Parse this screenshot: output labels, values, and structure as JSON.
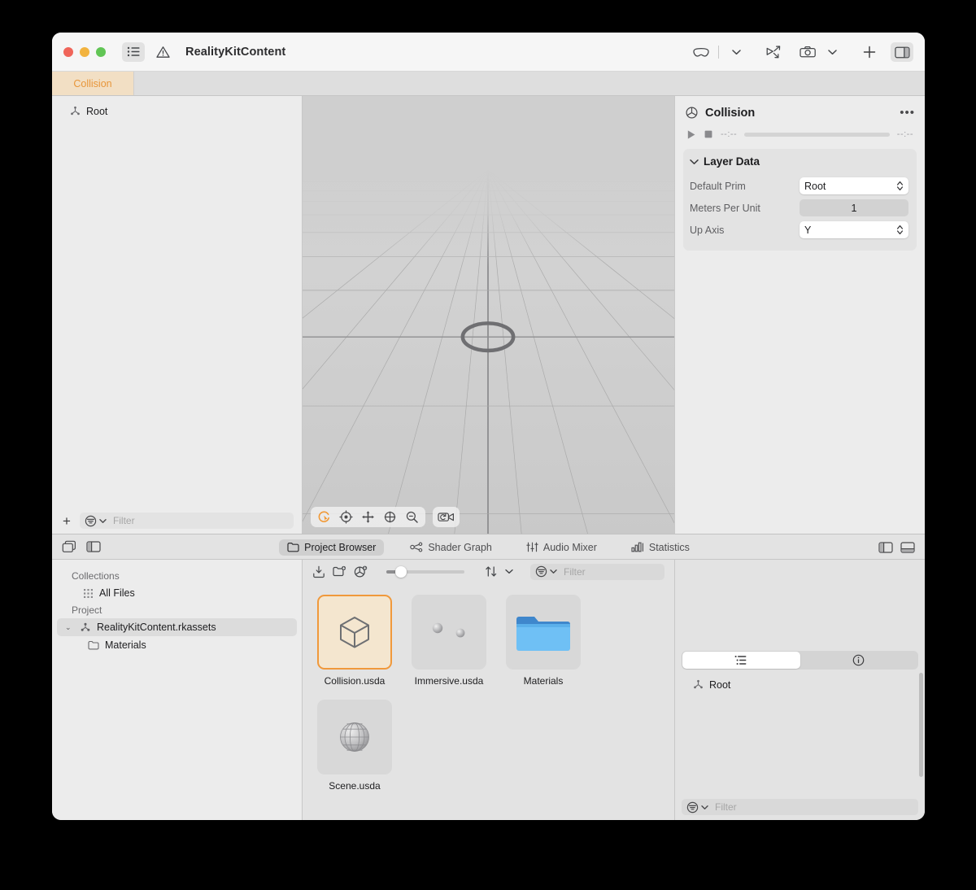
{
  "window": {
    "title": "RealityKitContent",
    "traffic": [
      "close",
      "minimize",
      "zoom"
    ],
    "toolbar_left": [
      "sidebar-list-icon",
      "warning-icon"
    ],
    "toolbar_right": [
      "vision-device-icon",
      "chevron-down-icon",
      "play-to-device-icon",
      "camera-icon",
      "chevron-down-icon",
      "add-icon",
      "inspector-toggle-icon"
    ]
  },
  "tabs": [
    {
      "label": "Collision",
      "selected": true
    }
  ],
  "outline": {
    "items": [
      {
        "label": "Root",
        "icon": "prim-node-icon"
      }
    ],
    "footer": {
      "add_label": "+",
      "filter_placeholder": "Filter"
    }
  },
  "viewport": {
    "tools": [
      {
        "name": "orbit",
        "active": true
      },
      {
        "name": "look-around",
        "active": false
      },
      {
        "name": "pan",
        "active": false
      },
      {
        "name": "orbit-globe",
        "active": false
      },
      {
        "name": "zoom",
        "active": false
      }
    ],
    "camera_reset": "reset-camera-icon"
  },
  "inspector": {
    "title": "Collision",
    "icon": "prim-cube-icon",
    "more_label": "•••",
    "transport": {
      "play": "play-icon",
      "stop": "stop-icon",
      "time_start": "--:--",
      "time_end": "--:--"
    },
    "section": {
      "title": "Layer Data",
      "expanded": true,
      "rows": [
        {
          "label": "Default Prim",
          "value": "Root",
          "type": "popup"
        },
        {
          "label": "Meters Per Unit",
          "value": "1",
          "type": "field"
        },
        {
          "label": "Up Axis",
          "value": "Y",
          "type": "popup"
        }
      ]
    }
  },
  "bottom_bar": {
    "left_icons": [
      "stack-panes-icon",
      "left-pane-toggle-icon"
    ],
    "tabs": [
      {
        "label": "Project Browser",
        "icon": "folder-icon",
        "selected": true
      },
      {
        "label": "Shader Graph",
        "icon": "shader-nodes-icon",
        "selected": false
      },
      {
        "label": "Audio Mixer",
        "icon": "mixer-sliders-icon",
        "selected": false
      },
      {
        "label": "Statistics",
        "icon": "bar-chart-icon",
        "selected": false
      }
    ],
    "right_icons": [
      "right-pane-toggle-icon",
      "bottom-pane-toggle-icon"
    ]
  },
  "project_browser": {
    "sidebar": {
      "groups": [
        {
          "title": "Collections",
          "items": [
            {
              "label": "All Files",
              "icon": "all-files-icon",
              "indent": 1,
              "selected": false,
              "twisty": ""
            }
          ]
        },
        {
          "title": "Project",
          "items": [
            {
              "label": "RealityKitContent.rkassets",
              "icon": "rkassets-icon",
              "indent": 0,
              "selected": true,
              "twisty": "⌄"
            },
            {
              "label": "Materials",
              "icon": "folder-icon",
              "indent": 1,
              "selected": false,
              "twisty": ""
            }
          ]
        }
      ]
    },
    "toolbar": {
      "icons": [
        "import-icon",
        "new-folder-icon",
        "new-asset-icon"
      ],
      "zoom_value": 12,
      "sort_icon": "sort-arrows-icon",
      "sort_chevron": "chevron-down-icon",
      "filter_icon": "filter-icon",
      "filter_placeholder": "Filter"
    },
    "assets": [
      {
        "name": "Collision.usda",
        "icon": "cube-wireframe-icon",
        "selected": true
      },
      {
        "name": "Immersive.usda",
        "icon": "two-spheres-icon",
        "selected": false
      },
      {
        "name": "Materials",
        "icon": "blue-folder-icon",
        "selected": false
      },
      {
        "name": "Scene.usda",
        "icon": "wireframe-sphere-icon",
        "selected": false
      }
    ],
    "inspector": {
      "segments": [
        {
          "icon": "outline-list-icon",
          "selected": true
        },
        {
          "icon": "info-circle-icon",
          "selected": false
        }
      ],
      "tree": [
        {
          "label": "Root",
          "icon": "prim-node-icon"
        }
      ],
      "footer": {
        "filter_icon": "filter-icon",
        "filter_placeholder": "Filter"
      }
    }
  },
  "colors": {
    "accent_orange": "#f0993c",
    "tab_selected_bg": "#f2dfc4",
    "tab_selected_text": "#e8963a",
    "folder_blue": "#63b5f2",
    "window_bg": "#ececec"
  }
}
